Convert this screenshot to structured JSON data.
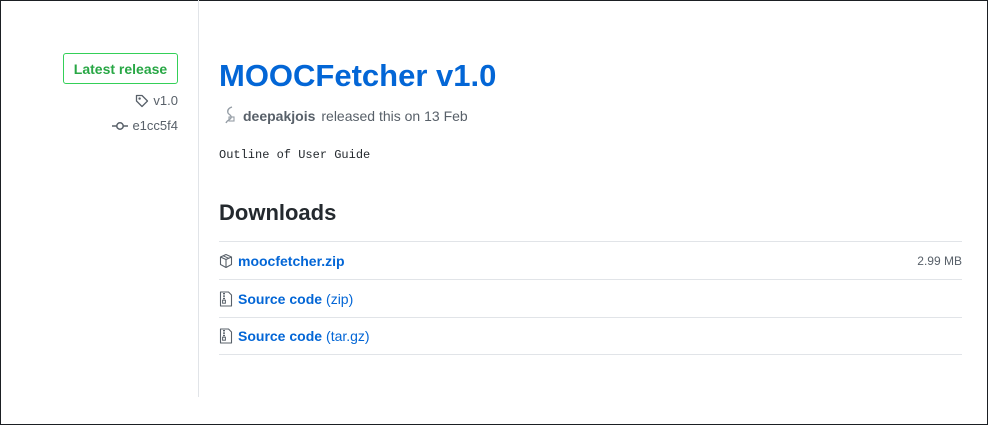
{
  "release": {
    "badge_label": "Latest release",
    "tag": "v1.0",
    "commit": "e1cc5f4",
    "title": "MOOCFetcher v1.0",
    "author": "deepakjois",
    "released_text": "released this on 13 Feb",
    "notes": "Outline of User Guide"
  },
  "downloads": {
    "heading": "Downloads",
    "assets": [
      {
        "name": "moocfetcher.zip",
        "format": "",
        "size": "2.99 MB",
        "icon": "package-icon"
      },
      {
        "name": "Source code",
        "format": "(zip)",
        "size": "",
        "icon": "file-zip-icon"
      },
      {
        "name": "Source code",
        "format": "(tar.gz)",
        "size": "",
        "icon": "file-zip-icon"
      }
    ]
  },
  "colors": {
    "link": "#0366d6",
    "latest_green": "#28a745",
    "muted": "#586069",
    "border": "#e1e4e8"
  }
}
